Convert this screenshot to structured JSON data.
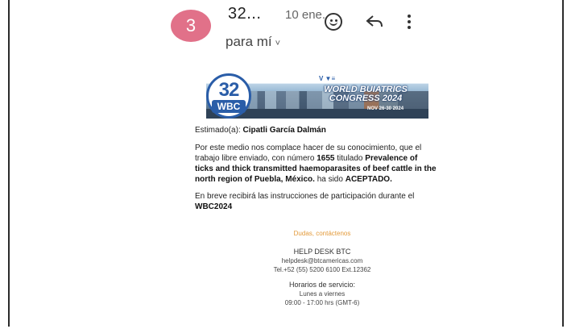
{
  "header": {
    "avatar_letter": "3",
    "sender": "32...",
    "date": "10 ene.",
    "recipient": "para mí",
    "icons": [
      "emoji-icon",
      "reply-icon",
      "more-vert-icon"
    ]
  },
  "banner": {
    "logo_number": "32",
    "logo_text": "WBC",
    "congress_line1": "WORLD BUIATRICS",
    "congress_line2": "CONGRESS 2024",
    "sponsor_marks": "V  ▼≡",
    "dates_text": "NOV 26-30 2024"
  },
  "letter": {
    "greeting_label": "Estimado(a):",
    "greeting_name": "Cipatli García Dalmán",
    "p1_a": "Por este medio nos complace hacer de su conocimiento, que el trabajo libre enviado, con número",
    "p1_num": "1655",
    "p1_b": "titulado",
    "p1_title": "Prevalence of ticks and thick transmitted haemoparasites of beef cattle in the north region of Puebla, México.",
    "p1_c": "ha sido",
    "p1_status": "ACEPTADO.",
    "p2_a": "En breve recibirá las instrucciones de participación durante el",
    "p2_event": "WBC2024"
  },
  "footer": {
    "doubts": "Dudas, contáctenos",
    "helpdesk_title": "HELP DESK BTC",
    "helpdesk_email": "helpdesk@btcamericas.com",
    "helpdesk_phone": "Tel.+52 (55) 5200 6100 Ext.12362",
    "hours_title": "Horarios de servicio:",
    "hours_days": "Lunes a viernes",
    "hours_time": "09:00 - 17:00 hrs (GMT-6)"
  },
  "colors": {
    "avatar": "#e17189",
    "brand_blue": "#2a5da8",
    "link_orange": "#e39a3a"
  }
}
